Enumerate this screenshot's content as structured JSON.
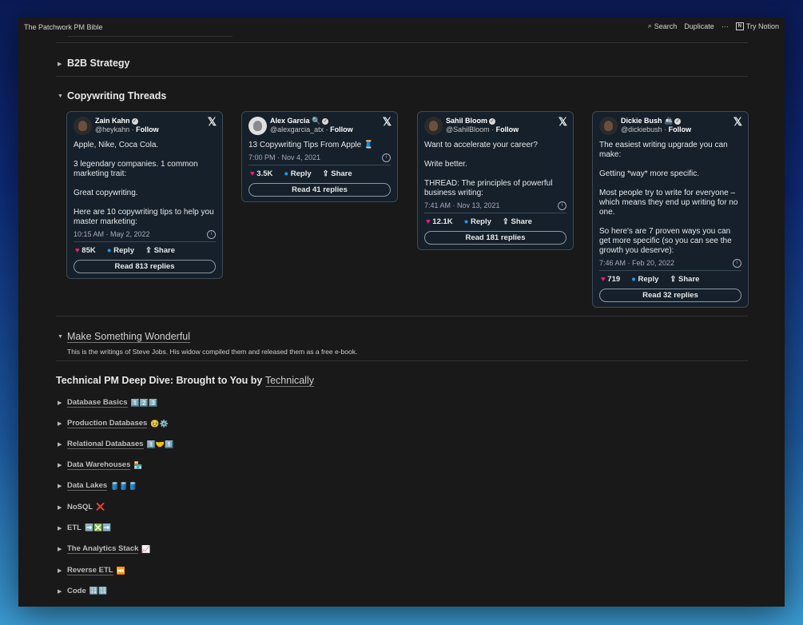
{
  "window": {
    "title": "The Patchwork PM Bible"
  },
  "topbar": {
    "search_label": "Search",
    "duplicate_label": "Duplicate",
    "more_label": "···",
    "try_notion_label": "Try Notion"
  },
  "sections": {
    "b2b": {
      "label": "B2B Strategy"
    },
    "copywriting": {
      "label": "Copywriting Threads"
    },
    "wonderful": {
      "label": "Make Something Wonderful",
      "description": "This is the writings of Steve Jobs. His widow compiled them and released them as a free e-book."
    }
  },
  "tweets": [
    {
      "name": "Zain Kahn",
      "badge": "",
      "handle": "@heykahn",
      "follow": "Follow",
      "body": "Apple, Nike, Coca Cola.\n\n3 legendary companies. 1 common marketing trait:\n\nGreat copywriting.\n\nHere are 10 copywriting tips to help you master marketing:",
      "timestamp": "10:15 AM · May 2, 2022",
      "likes": "85K",
      "reply": "Reply",
      "share": "Share",
      "read_replies": "Read 813 replies"
    },
    {
      "name": "Alex Garcia",
      "badge": "🔍",
      "handle": "@alexgarcia_atx",
      "follow": "Follow",
      "body": "13 Copywriting Tips From Apple 🧵",
      "timestamp": "7:00 PM · Nov 4, 2021",
      "likes": "3.5K",
      "reply": "Reply",
      "share": "Share",
      "read_replies": "Read 41 replies"
    },
    {
      "name": "Sahil Bloom",
      "badge": "",
      "handle": "@SahilBloom",
      "follow": "Follow",
      "body": "Want to accelerate your career?\n\nWrite better.\n\nTHREAD: The principles of powerful business writing:",
      "timestamp": "7:41 AM · Nov 13, 2021",
      "likes": "12.1K",
      "reply": "Reply",
      "share": "Share",
      "read_replies": "Read 181 replies"
    },
    {
      "name": "Dickie Bush",
      "badge": "🚢",
      "handle": "@dickiebush",
      "follow": "Follow",
      "body": "The easiest writing upgrade you can make:\n\nGetting *way* more specific.\n\nMost people try to write for everyone – which means they end up writing for no one.\n\nSo here's are 7 proven ways you can get more specific (so you can see the growth you deserve):",
      "timestamp": "7:46 AM · Feb 20, 2022",
      "likes": "719",
      "reply": "Reply",
      "share": "Share",
      "read_replies": "Read 32 replies"
    }
  ],
  "tech": {
    "heading_prefix": "Technical PM Deep Dive: Brought to You by ",
    "heading_link": "Technically"
  },
  "tech_items": [
    {
      "label": "Database Basics",
      "emoji": "1️⃣2️⃣3️⃣"
    },
    {
      "label": "Production Databases",
      "emoji": "🥹⚙️"
    },
    {
      "label": "Relational Databases",
      "emoji": "1️⃣🤝1️⃣"
    },
    {
      "label": "Data Warehouses",
      "emoji": "🏪"
    },
    {
      "label": "Data Lakes",
      "emoji": "🛢️🛢️🛢️"
    },
    {
      "label": "NoSQL",
      "emoji": "❌"
    },
    {
      "label": "ETL",
      "emoji": "➡️❎➡️"
    },
    {
      "label": "The Analytics Stack",
      "emoji": "📈"
    },
    {
      "label": "Reverse ETL",
      "emoji": "⏮️"
    },
    {
      "label": "Code",
      "emoji": "🔢🔢"
    }
  ]
}
